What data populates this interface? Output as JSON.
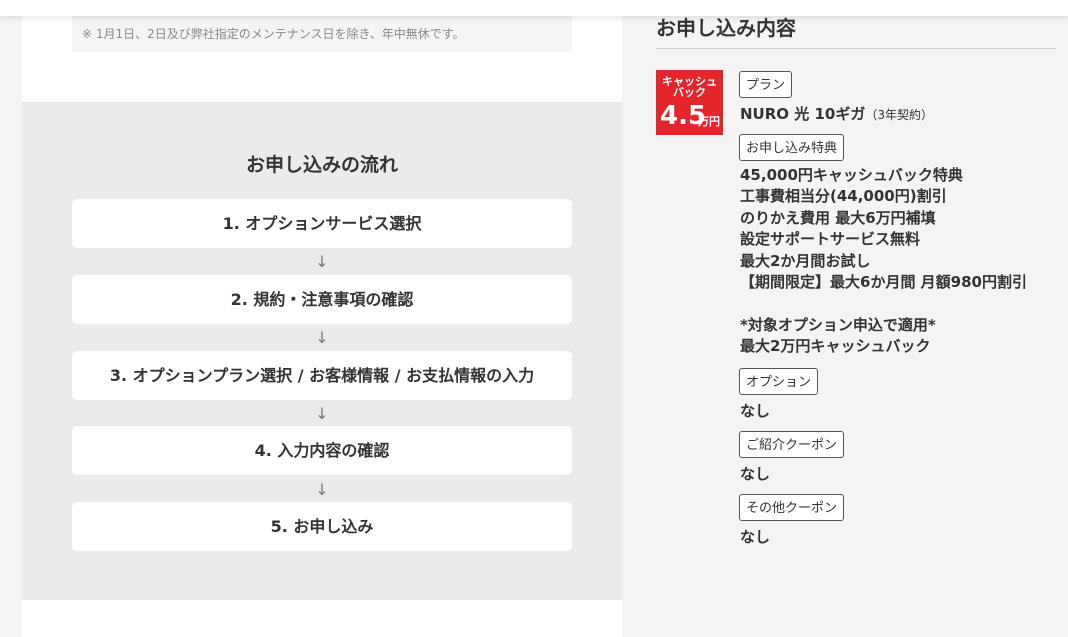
{
  "notice": "※ 1月1日、2日及び弊社指定のメンテナンス日を除き、年中無休です。",
  "flow": {
    "title": "お申し込みの流れ",
    "steps": [
      "1. オプションサービス選択",
      "2. 規約・注意事項の確認",
      "3. オプションプラン選択 / お客様情報 / お支払情報の入力",
      "4. 入力内容の確認",
      "5. お申し込み"
    ],
    "arrow": "↓"
  },
  "summary": {
    "title": "お申し込み内容",
    "badge": {
      "line1": "キャッシュ",
      "line2": "バック",
      "amount": "4.5",
      "unit": "万円",
      "color": "#e2262b"
    },
    "plan_label": "プラン",
    "plan_name": "NURO 光 10ギガ",
    "plan_term": "（3年契約）",
    "benefit_label": "お申し込み特典",
    "benefits": [
      "45,000円キャッシュバック特典",
      "工事費相当分(44,000円)割引",
      "のりかえ費用 最大6万円補填",
      "設定サポートサービス無料",
      "最大2か月間お試し",
      "【期間限定】最大6か月間 月額980円割引",
      "",
      "*対象オプション申込で適用*",
      "最大2万円キャッシュバック"
    ],
    "option_label": "オプション",
    "option_value": "なし",
    "coupon_label": "ご紹介クーポン",
    "coupon_value": "なし",
    "other_coupon_label": "その他クーポン",
    "other_coupon_value": "なし"
  }
}
